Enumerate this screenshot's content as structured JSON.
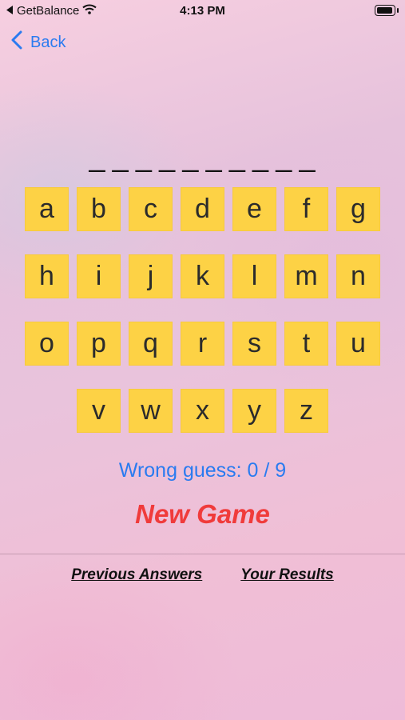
{
  "status_bar": {
    "carrier": "GetBalance",
    "time": "4:13 PM"
  },
  "nav": {
    "back_label": "Back"
  },
  "game": {
    "word_blanks": "__________",
    "keyboard_rows": [
      [
        "a",
        "b",
        "c",
        "d",
        "e",
        "f",
        "g"
      ],
      [
        "h",
        "i",
        "j",
        "k",
        "l",
        "m",
        "n"
      ],
      [
        "o",
        "p",
        "q",
        "r",
        "s",
        "t",
        "u"
      ],
      [
        "v",
        "w",
        "x",
        "y",
        "z"
      ]
    ],
    "wrong_guess": "Wrong guess: 0 / 9",
    "new_game": "New Game"
  },
  "footer": {
    "previous_answers": "Previous Answers",
    "your_results": "Your Results"
  },
  "colors": {
    "key_fill": "#fdd245",
    "accent_blue": "#2a7bf0",
    "new_game_red": "#f03b3b"
  }
}
